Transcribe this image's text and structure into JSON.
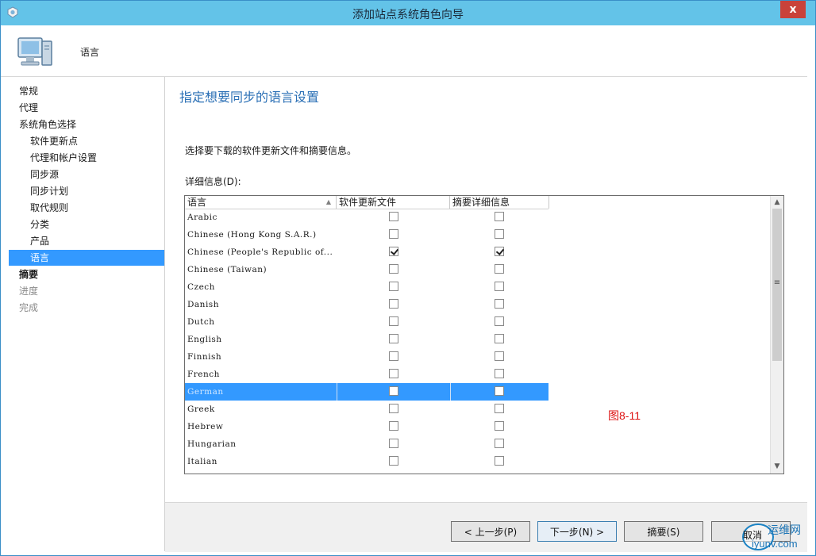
{
  "window": {
    "title": "添加站点系统角色向导",
    "close_glyph": "x"
  },
  "header": {
    "title": "语言"
  },
  "sidebar": {
    "items": [
      {
        "label": "常规",
        "level": "top",
        "state": "normal"
      },
      {
        "label": "代理",
        "level": "top",
        "state": "normal"
      },
      {
        "label": "系统角色选择",
        "level": "top",
        "state": "normal"
      },
      {
        "label": "软件更新点",
        "level": "sub",
        "state": "normal"
      },
      {
        "label": "代理和帐户设置",
        "level": "sub",
        "state": "normal"
      },
      {
        "label": "同步源",
        "level": "sub",
        "state": "normal"
      },
      {
        "label": "同步计划",
        "level": "sub",
        "state": "normal"
      },
      {
        "label": "取代规则",
        "level": "sub",
        "state": "normal"
      },
      {
        "label": "分类",
        "level": "sub",
        "state": "normal"
      },
      {
        "label": "产品",
        "level": "sub",
        "state": "normal"
      },
      {
        "label": "语言",
        "level": "sub",
        "state": "active"
      },
      {
        "label": "摘要",
        "level": "top",
        "state": "normal"
      },
      {
        "label": "进度",
        "level": "top",
        "state": "disabled"
      },
      {
        "label": "完成",
        "level": "top",
        "state": "disabled"
      }
    ]
  },
  "main": {
    "heading": "指定想要同步的语言设置",
    "instruction": "选择要下载的软件更新文件和摘要信息。",
    "details_label": "详细信息(D):",
    "grid": {
      "columns": [
        "语言",
        "软件更新文件",
        "摘要详细信息"
      ],
      "sort_glyph": "▲",
      "rows": [
        {
          "language": "Arabic",
          "update_files": false,
          "summary": false,
          "selected": false
        },
        {
          "language": "Chinese (Hong Kong S.A.R.)",
          "update_files": false,
          "summary": false,
          "selected": false
        },
        {
          "language": "Chinese (People's Republic of...",
          "update_files": true,
          "summary": true,
          "selected": false
        },
        {
          "language": "Chinese (Taiwan)",
          "update_files": false,
          "summary": false,
          "selected": false
        },
        {
          "language": "Czech",
          "update_files": false,
          "summary": false,
          "selected": false
        },
        {
          "language": "Danish",
          "update_files": false,
          "summary": false,
          "selected": false
        },
        {
          "language": "Dutch",
          "update_files": false,
          "summary": false,
          "selected": false
        },
        {
          "language": "English",
          "update_files": false,
          "summary": false,
          "selected": false
        },
        {
          "language": "Finnish",
          "update_files": false,
          "summary": false,
          "selected": false
        },
        {
          "language": "French",
          "update_files": false,
          "summary": false,
          "selected": false
        },
        {
          "language": "German",
          "update_files": false,
          "summary": false,
          "selected": true
        },
        {
          "language": "Greek",
          "update_files": false,
          "summary": false,
          "selected": false
        },
        {
          "language": "Hebrew",
          "update_files": false,
          "summary": false,
          "selected": false
        },
        {
          "language": "Hungarian",
          "update_files": false,
          "summary": false,
          "selected": false
        },
        {
          "language": "Italian",
          "update_files": false,
          "summary": false,
          "selected": false
        }
      ]
    },
    "scrollbar": {
      "up": "▲",
      "down": "▼",
      "grip": "≡"
    }
  },
  "annotation": {
    "figure_label": "图8-11"
  },
  "footer": {
    "prev_label": "< 上一步(P)",
    "next_label": "下一步(N) >",
    "summary_label": "摘要(S)",
    "cancel_label": "取消"
  },
  "watermark": {
    "text_cn": "运维网",
    "text_url": "iyunv.com"
  },
  "colors": {
    "titlebar": "#63c3e8",
    "selection": "#3399ff",
    "heading": "#2a6fb5",
    "figure_label": "#dd1111"
  }
}
